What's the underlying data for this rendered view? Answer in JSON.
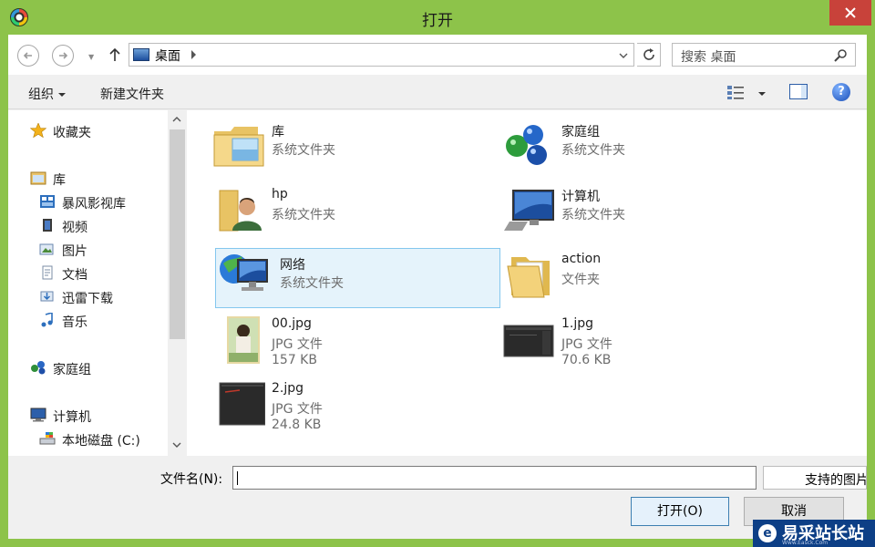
{
  "window": {
    "title": "打开",
    "accent_color": "#8dc34a",
    "close_color": "#c8423a"
  },
  "navigation": {
    "back_icon": "back-arrow-icon",
    "forward_icon": "forward-arrow-icon",
    "up_icon": "up-arrow-icon",
    "address_path": "桌面",
    "search_placeholder": "搜索 桌面"
  },
  "toolbar": {
    "organize_label": "组织",
    "new_folder_label": "新建文件夹"
  },
  "sidebar": {
    "favorites": "收藏夹",
    "libraries": "库",
    "lib_items": [
      "暴风影视库",
      "视频",
      "图片",
      "文档",
      "迅雷下载",
      "音乐"
    ],
    "homegroup": "家庭组",
    "computer": "计算机",
    "drive_c": "本地磁盘 (C:)"
  },
  "files": [
    {
      "name": "库",
      "type": "系统文件夹",
      "size": "",
      "icon": "library-folder-icon"
    },
    {
      "name": "家庭组",
      "type": "系统文件夹",
      "size": "",
      "icon": "homegroup-icon"
    },
    {
      "name": "hp",
      "type": "系统文件夹",
      "size": "",
      "icon": "user-folder-icon"
    },
    {
      "name": "计算机",
      "type": "系统文件夹",
      "size": "",
      "icon": "computer-icon"
    },
    {
      "name": "网络",
      "type": "系统文件夹",
      "size": "",
      "icon": "network-icon",
      "selected": true
    },
    {
      "name": "action",
      "type": "文件夹",
      "size": "",
      "icon": "folder-icon"
    },
    {
      "name": "00.jpg",
      "type": "JPG 文件",
      "size": "157 KB",
      "icon": "jpg-thumbnail-icon"
    },
    {
      "name": "1.jpg",
      "type": "JPG 文件",
      "size": "70.6 KB",
      "icon": "jpg-thumbnail-icon"
    },
    {
      "name": "2.jpg",
      "type": "JPG 文件",
      "size": "24.8 KB",
      "icon": "jpg-thumbnail-icon"
    }
  ],
  "bottom": {
    "filename_label": "文件名(N):",
    "filename_value": "",
    "filter_text": "支持的图片",
    "open_label": "打开(O)",
    "cancel_label": "取消"
  },
  "watermark": {
    "text": "易采站长站",
    "url": "Www.Easck.Com"
  }
}
